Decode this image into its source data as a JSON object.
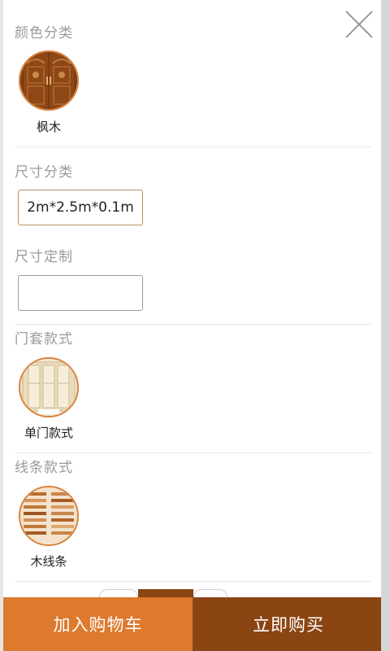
{
  "close_icon": "close-icon",
  "color_section": {
    "title": "颜色分类",
    "option": {
      "label": "枫木",
      "icon": "wooden-door-swatch"
    }
  },
  "size_section": {
    "title": "尺寸分类",
    "selected_value": "2m*2.5m*0.1m"
  },
  "custom_size_section": {
    "title": "尺寸定制",
    "input_value": "",
    "input_placeholder": ""
  },
  "frame_style_section": {
    "title": "门套款式",
    "option": {
      "label": "单门款式",
      "icon": "door-frame-swatch"
    }
  },
  "molding_style_section": {
    "title": "线条款式",
    "option": {
      "label": "木线条",
      "icon": "wood-molding-swatch"
    }
  },
  "actions": {
    "add_to_cart": "加入购物车",
    "buy_now": "立即购买"
  },
  "colors": {
    "accent": "#dd7a2e",
    "accent_dark": "#8b4513",
    "swatch_border": "#d9823c"
  }
}
